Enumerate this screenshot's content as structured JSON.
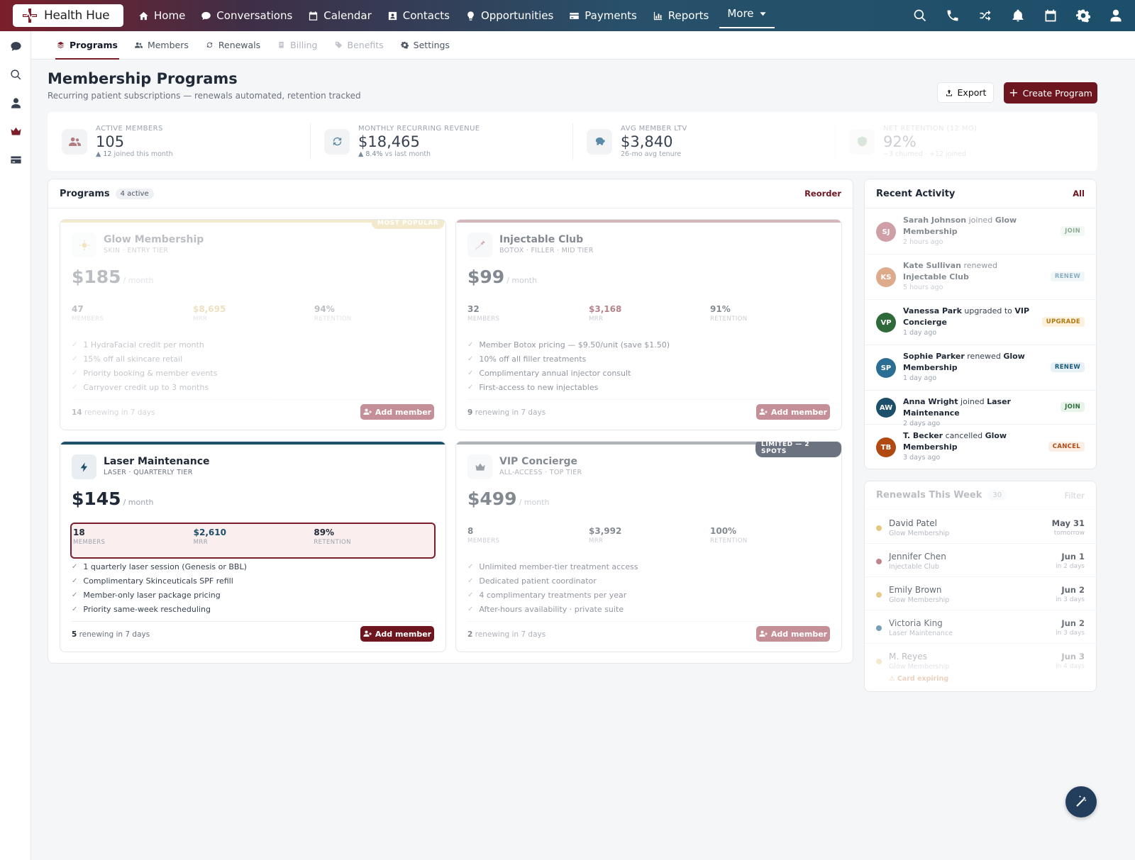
{
  "app": {
    "name": "Health Hue"
  },
  "nav": {
    "items": [
      {
        "label": "Home",
        "icon": "home-icon"
      },
      {
        "label": "Conversations",
        "icon": "chat-icon"
      },
      {
        "label": "Calendar",
        "icon": "calendar-icon"
      },
      {
        "label": "Contacts",
        "icon": "contact-card-icon"
      },
      {
        "label": "Opportunities",
        "icon": "lightbulb-icon"
      },
      {
        "label": "Payments",
        "icon": "credit-card-icon"
      },
      {
        "label": "Reports",
        "icon": "bar-chart-icon"
      }
    ],
    "more": "More",
    "right_icons": [
      "search-icon",
      "phone-icon",
      "shuffle-icon",
      "bell-icon",
      "calendar-icon",
      "gear-icon",
      "user-icon"
    ]
  },
  "sidebar": {
    "icons": [
      "chat-icon",
      "search-icon",
      "user-icon",
      "crown-icon",
      "card-icon"
    ],
    "accent": "#7a1f2a"
  },
  "subnav": {
    "items": [
      {
        "label": "Programs",
        "state": "active"
      },
      {
        "label": "Members",
        "state": "normal"
      },
      {
        "label": "Renewals",
        "state": "normal"
      },
      {
        "label": "Billing",
        "state": "disabled"
      },
      {
        "label": "Benefits",
        "state": "disabled"
      },
      {
        "label": "Settings",
        "state": "normal"
      }
    ]
  },
  "header": {
    "title": "Membership Programs",
    "subtitle": "Recurring patient subscriptions — renewals automated, retention tracked",
    "export_label": "Export",
    "create_label": "Create Program"
  },
  "stats": [
    {
      "label": "ACTIVE MEMBERS",
      "value": "105",
      "delta": "▲ 12",
      "note": "joined this month"
    },
    {
      "label": "MONTHLY RECURRING REVENUE",
      "value": "$18,465",
      "delta": "▲ 8.4%",
      "note": "vs last month"
    },
    {
      "label": "AVG MEMBER LTV",
      "value": "$3,840",
      "delta": "",
      "note": "26-mo avg tenure"
    },
    {
      "label": "NET RETENTION (12 MO)",
      "value": "92%",
      "delta": "",
      "note": "−3 churned · +12 joined"
    }
  ],
  "programs_panel": {
    "title": "Programs",
    "badge": "4 active",
    "reorder": "Reorder"
  },
  "programs": [
    {
      "name": "Glow Membership",
      "tier": "SKIN · ENTRY TIER",
      "price": "$185",
      "per": "/ month",
      "members": "47",
      "mrr": "$8,695",
      "retention": "94%",
      "members_label": "MEMBERS",
      "mrr_label": "MRR",
      "retention_label": "RETENTION",
      "features": [
        "1 HydraFacial credit per month",
        "15% off all skincare retail",
        "Priority booking & member events",
        "Carryover credit up to 3 months"
      ],
      "renew_count": "14",
      "renew_text": "renewing in 7 days",
      "add_label": "Add member",
      "ribbon": "MOST POPULAR",
      "accent": "#d8b75a",
      "icon": "sun-icon"
    },
    {
      "name": "Injectable Club",
      "tier": "BOTOX · FILLER · MID TIER",
      "price": "$99",
      "per": "/ month",
      "members": "32",
      "mrr": "$3,168",
      "retention": "91%",
      "members_label": "MEMBERS",
      "mrr_label": "MRR",
      "retention_label": "RETENTION",
      "features": [
        "Member Botox pricing — $9.50/unit (save $1.50)",
        "10% off all filler treatments",
        "Complimentary annual injector consult",
        "First-access to new injectables"
      ],
      "renew_count": "9",
      "renew_text": "renewing in 7 days",
      "add_label": "Add member",
      "ribbon": "",
      "accent": "#b07c82",
      "icon": "syringe-icon"
    },
    {
      "name": "Laser Maintenance",
      "tier": "LASER · QUARTERLY TIER",
      "price": "$145",
      "per": "/ month",
      "members": "18",
      "mrr": "$2,610",
      "retention": "89%",
      "members_label": "MEMBERS",
      "mrr_label": "MRR",
      "retention_label": "RETENTION",
      "features": [
        "1 quarterly laser session (Genesis or BBL)",
        "Complimentary Skinceuticals SPF refill",
        "Member-only laser package pricing",
        "Priority same-week rescheduling"
      ],
      "renew_count": "5",
      "renew_text": "renewing in 7 days",
      "add_label": "Add member",
      "ribbon": "",
      "accent": "#1d4f6a",
      "icon": "bolt-icon"
    },
    {
      "name": "VIP Concierge",
      "tier": "ALL-ACCESS · TOP TIER",
      "price": "$499",
      "per": "/ month",
      "members": "8",
      "mrr": "$3,992",
      "retention": "100%",
      "members_label": "MEMBERS",
      "mrr_label": "MRR",
      "retention_label": "RETENTION",
      "features": [
        "Unlimited member-tier treatment access",
        "Dedicated patient coordinator",
        "4 complimentary treatments per year",
        "After-hours availability · private suite"
      ],
      "renew_count": "2",
      "renew_text": "renewing in 7 days",
      "add_label": "Add member",
      "ribbon": "LIMITED — 2 SPOTS",
      "accent": "#6b7280",
      "icon": "crown-icon"
    }
  ],
  "activity": {
    "title": "Recent Activity",
    "all": "All",
    "items": [
      {
        "initials": "SJ",
        "color": "#a8525e",
        "name": "Sarah Johnson",
        "verb": "joined",
        "target": "Glow Membership",
        "time": "2 hours ago",
        "tag": "JOIN"
      },
      {
        "initials": "KS",
        "color": "#c2682e",
        "name": "Kate Sullivan",
        "verb": "renewed",
        "target": "Injectable Club",
        "time": "5 hours ago",
        "tag": "RENEW"
      },
      {
        "initials": "VP",
        "color": "#2f6b3a",
        "name": "Vanessa Park",
        "verb": "upgraded to",
        "target": "VIP Concierge",
        "time": "1 day ago",
        "tag": "UPGRADE"
      },
      {
        "initials": "SP",
        "color": "#2c6e93",
        "name": "Sophie Parker",
        "verb": "renewed",
        "target": "Glow Membership",
        "time": "1 day ago",
        "tag": "RENEW"
      },
      {
        "initials": "AW",
        "color": "#1d4f6a",
        "name": "Anna Wright",
        "verb": "joined",
        "target": "Laser Maintenance",
        "time": "2 days ago",
        "tag": "JOIN"
      },
      {
        "initials": "TB",
        "color": "#b04a12",
        "name": "T. Becker",
        "verb": "cancelled",
        "target": "Glow Membership",
        "time": "3 days ago",
        "tag": "CANCEL"
      }
    ]
  },
  "renewals": {
    "title": "Renewals This Week",
    "badge": "30",
    "filter": "Filter",
    "items": [
      {
        "name": "David Patel",
        "program": "Glow Membership",
        "date": "May 31",
        "rel": "tomorrow",
        "dot": "#d8b75a",
        "warn": ""
      },
      {
        "name": "Jennifer Chen",
        "program": "Injectable Club",
        "date": "Jun 1",
        "rel": "in 2 days",
        "dot": "#a8525e",
        "warn": ""
      },
      {
        "name": "Emily Brown",
        "program": "Glow Membership",
        "date": "Jun 2",
        "rel": "in 3 days",
        "dot": "#d8b75a",
        "warn": ""
      },
      {
        "name": "Victoria King",
        "program": "Laser Maintenance",
        "date": "Jun 2",
        "rel": "in 3 days",
        "dot": "#2c6e93",
        "warn": ""
      },
      {
        "name": "M. Reyes",
        "program": "Glow Membership",
        "date": "Jun 3",
        "rel": "in 4 days",
        "dot": "#d8b75a",
        "warn": "⚠ Card expiring"
      }
    ]
  }
}
